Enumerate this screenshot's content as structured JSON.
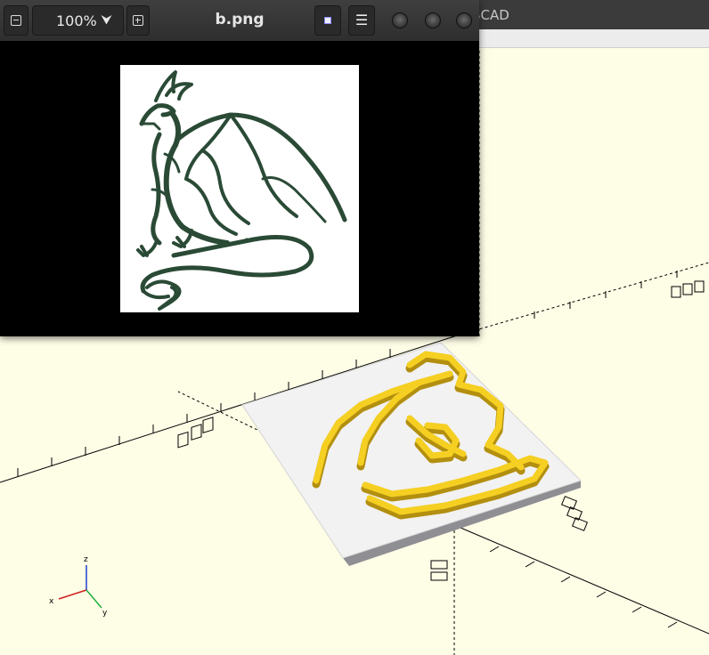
{
  "background_app": {
    "title_fragment": "SCAD",
    "axis_labels": {
      "x": "x",
      "y": "y",
      "z": "z"
    }
  },
  "viewer": {
    "title": "b.png",
    "zoom_level": "100%",
    "icons": {
      "zoom_out": "zoom-out-icon",
      "zoom_dropdown": "chevron-down-icon",
      "zoom_in": "zoom-in-icon",
      "image_mode": "image-icon",
      "menu": "hamburger-menu-icon",
      "window_controls": [
        "minimize-icon",
        "maximize-icon",
        "close-icon"
      ]
    }
  },
  "colors": {
    "dragon_print": "#2a4a36",
    "model_plate": "#f2f2f2",
    "model_relief": "#f5cf22",
    "viewport_bg": "#fefde6"
  }
}
